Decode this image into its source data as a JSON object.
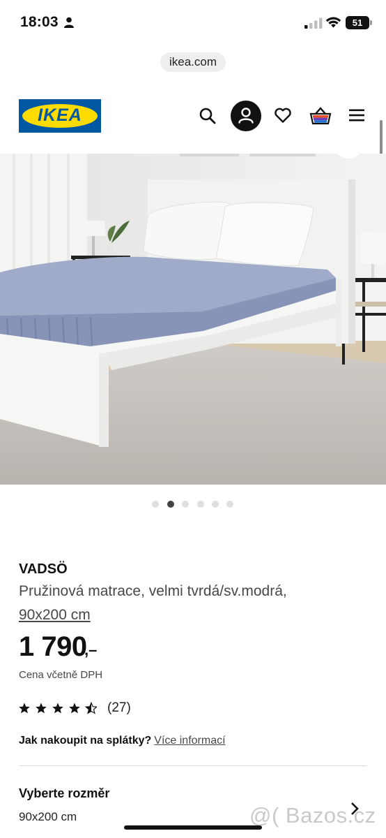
{
  "status_bar": {
    "time": "18:03",
    "battery": "51"
  },
  "browser": {
    "url": "ikea.com"
  },
  "header": {
    "logo_text": "IKEA",
    "icons": [
      "search-icon",
      "account-icon",
      "heart-icon",
      "basket-icon",
      "menu-icon"
    ]
  },
  "carousel": {
    "slide_count": 6,
    "active_index": 1
  },
  "product": {
    "brand": "VADSÖ",
    "description": "Pružinová matrace, velmi tvrdá/sv.modrá,",
    "size": "90x200 cm",
    "price": "1 790",
    "price_suffix": ",–",
    "vat_note": "Cena včetně DPH",
    "rating": 4.5,
    "review_count": "(27)"
  },
  "installment": {
    "label": "Jak nakoupit na splátky?",
    "link": "Více informací"
  },
  "size_selector": {
    "title": "Vyberte rozměr",
    "value": "90x200 cm"
  },
  "watermark": "@( Bazos.cz",
  "colors": {
    "ikea_blue": "#0058a3",
    "ikea_yellow": "#ffdb00",
    "mattress_blue": "#8d9bbd"
  }
}
